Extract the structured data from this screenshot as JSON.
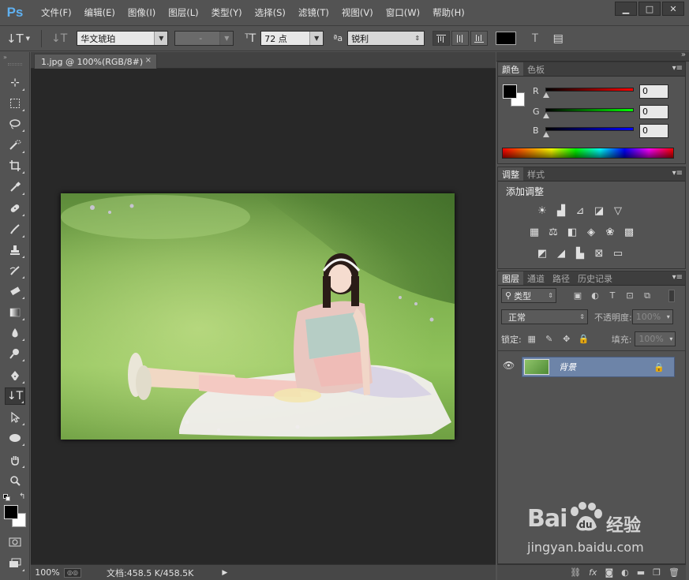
{
  "app": {
    "logo": "Ps"
  },
  "menu": [
    "文件(F)",
    "编辑(E)",
    "图像(I)",
    "图层(L)",
    "类型(Y)",
    "选择(S)",
    "滤镜(T)",
    "视图(V)",
    "窗口(W)",
    "帮助(H)"
  ],
  "window_controls": {
    "minimize": "▁",
    "restore": "□",
    "close": "✕"
  },
  "options": {
    "tool_glyph": "↓T",
    "orient_glyph": "↓T",
    "font_family": "华文琥珀",
    "font_style": "-",
    "size_glyph": "ᵀT",
    "font_size": "72 点",
    "aa_glyph": "ªa",
    "antialias": "锐利",
    "text_color": "#000000"
  },
  "document": {
    "tab_title": "1.jpg @ 100%(RGB/8#)",
    "tab_close": "×",
    "zoom": "100%",
    "doc_info": "文档:458.5 K/458.5K"
  },
  "color_panel": {
    "tabs": [
      "颜色",
      "色板"
    ],
    "channels": [
      {
        "label": "R",
        "value": "0",
        "gradient": "#ff0000"
      },
      {
        "label": "G",
        "value": "0",
        "gradient": "#00ff00"
      },
      {
        "label": "B",
        "value": "0",
        "gradient": "#0000ff"
      }
    ]
  },
  "adjust_panel": {
    "tabs": [
      "调整",
      "样式"
    ],
    "title": "添加调整"
  },
  "layers_panel": {
    "tabs": [
      "图层",
      "通道",
      "路径",
      "历史记录"
    ],
    "filter_type": "类型",
    "blend_mode": "正常",
    "opacity_label": "不透明度:",
    "opacity_value": "100%",
    "lock_label": "锁定:",
    "fill_label": "填充:",
    "fill_value": "100%",
    "layer_name": "背景"
  },
  "watermark": {
    "brand": "Bai",
    "brand2": "du",
    "jingyan": "经验",
    "url": "jingyan.baidu.com"
  }
}
